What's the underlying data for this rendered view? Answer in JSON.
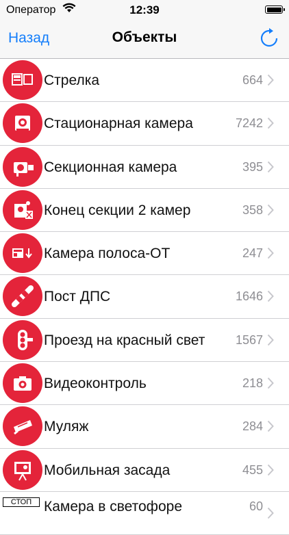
{
  "status": {
    "carrier": "Оператор",
    "time": "12:39"
  },
  "nav": {
    "back_label": "Назад",
    "title": "Объекты",
    "refresh_icon": "refresh-icon"
  },
  "accent_color": "#147efb",
  "badge_color": "#e4243a",
  "items": [
    {
      "label": "Стрелка",
      "count": "664",
      "icon": "strelka-icon"
    },
    {
      "label": "Стационарная камера",
      "count": "7242",
      "icon": "stationary-camera-icon"
    },
    {
      "label": "Секционная камера",
      "count": "395",
      "icon": "section-camera-icon"
    },
    {
      "label": "Конец секции 2 камер",
      "count": "358",
      "icon": "section-end-icon"
    },
    {
      "label": "Камера полоса-ОТ",
      "count": "247",
      "icon": "lane-camera-icon"
    },
    {
      "label": "Пост ДПС",
      "count": "1646",
      "icon": "police-post-icon"
    },
    {
      "label": "Проезд на красный свет",
      "count": "1567",
      "icon": "traffic-light-icon"
    },
    {
      "label": "Видеоконтроль",
      "count": "218",
      "icon": "video-control-icon"
    },
    {
      "label": "Муляж",
      "count": "284",
      "icon": "dummy-camera-icon"
    },
    {
      "label": "Мобильная засада",
      "count": "455",
      "icon": "mobile-ambush-icon"
    },
    {
      "label": "Камера в светофоре",
      "count": "60",
      "icon": "stop-sign-icon",
      "sign_text": "СТОП"
    }
  ]
}
